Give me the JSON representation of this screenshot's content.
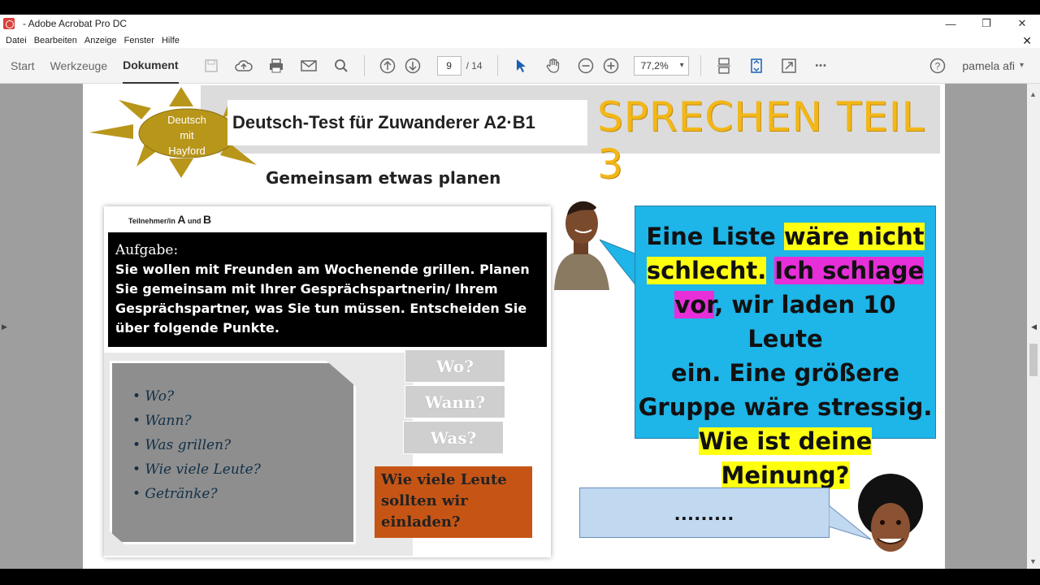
{
  "window": {
    "title": " - Adobe Acrobat Pro DC",
    "controls": {
      "minimize": "—",
      "restore": "❐",
      "close": "✕"
    }
  },
  "menu": {
    "items": [
      "Datei",
      "Bearbeiten",
      "Anzeige",
      "Fenster",
      "Hilfe"
    ],
    "close": "✕"
  },
  "toolbar": {
    "tabs": [
      {
        "label": "Start"
      },
      {
        "label": "Werkzeuge"
      },
      {
        "label": "Dokument",
        "active": true
      }
    ],
    "page_current": "9",
    "page_total": "/ 14",
    "zoom": "77,2%",
    "user": "pamela afi",
    "more": "•••"
  },
  "page": {
    "logo_text": [
      "Deutsch",
      "mit",
      "Hayford"
    ],
    "title": "Deutsch-Test für Zuwanderer A2·B1",
    "section": "SPRECHEN TEIL 3",
    "subtitle": "Gemeinsam etwas planen",
    "participants_prefix": "Teilnehmer/in",
    "participant_a": "A",
    "participants_and": "und",
    "participant_b": "B",
    "task_heading": "Aufgabe:",
    "task_body": "Sie wollen mit Freunden am Wochenende grillen. Planen Sie gemeinsam mit Ihrer Gesprächspartnerin/ Ihrem Gesprächspartner, was Sie tun müssen. Entscheiden Sie über folgende Punkte.",
    "notes": [
      "• Wo?",
      "• Wann?",
      "• Was grillen?",
      "• Wie viele Leute?",
      "• Getränke?"
    ],
    "questions": [
      "Wo?",
      "Wann?",
      "Was?"
    ],
    "orange_question": "Wie viele Leute sollten wir einladen?",
    "bubble": {
      "line1_pre": "Eine Liste ",
      "line1_hl": "wäre nicht",
      "line2_hl": "schlecht.",
      "line2_hl2": "Ich schlage",
      "line3_hl": "vor",
      "line3_post": ", wir laden 10 Leute",
      "line4": "ein. Eine größere",
      "line5": "Gruppe wäre stressig.",
      "line6_hl": "Wie ist deine Meinung?"
    },
    "reply": "........."
  },
  "colors": {
    "sun": "#b8961a",
    "section_title": "#f2b718",
    "bubble": "#1eb5e8",
    "highlight_yellow": "#ffff10",
    "highlight_magenta": "#e62fd9",
    "orange_box": "#c65515",
    "reply_bubble": "#c0d8f0"
  }
}
